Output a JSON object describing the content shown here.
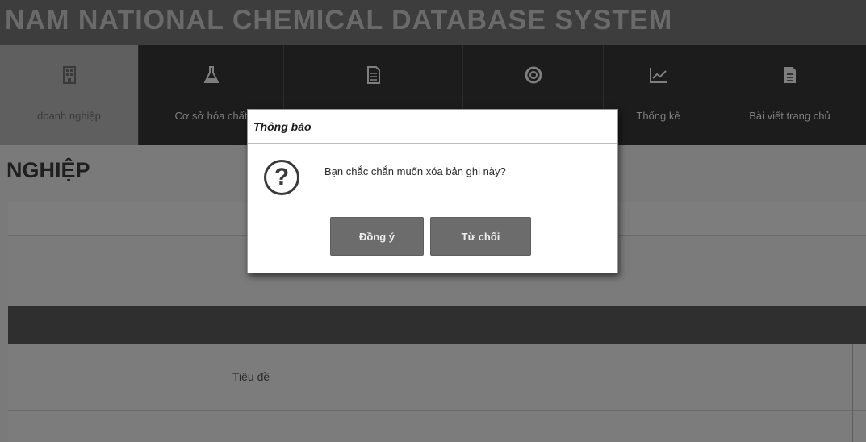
{
  "header": {
    "title": "NAM NATIONAL CHEMICAL DATABASE SYSTEM"
  },
  "nav": {
    "items": [
      {
        "label": "doanh nghiệp",
        "icon": "building-icon",
        "active": true
      },
      {
        "label": "Cơ sở hóa chất",
        "icon": "flask-icon",
        "active": false
      },
      {
        "label": "",
        "icon": "document-icon",
        "active": false
      },
      {
        "label": "",
        "icon": "lifebuoy-icon",
        "active": false
      },
      {
        "label": "Thống kê",
        "icon": "chart-line-icon",
        "active": false
      },
      {
        "label": "Bài viết trang chủ",
        "icon": "file-text-icon",
        "active": false
      }
    ]
  },
  "content": {
    "section_title": "NGHIỆP",
    "table": {
      "column_title": "Tiêu đề"
    }
  },
  "dialog": {
    "title": "Thông báo",
    "icon": "question-icon",
    "icon_glyph": "?",
    "message": "Bạn chắc chắn muốn xóa bản ghi này?",
    "confirm_label": "Đồng ý",
    "cancel_label": "Từ chối"
  },
  "colors": {
    "overlay_background": "#7a7a7a",
    "nav_background": "#1c1c1c",
    "button_background": "#6c6c6c"
  }
}
